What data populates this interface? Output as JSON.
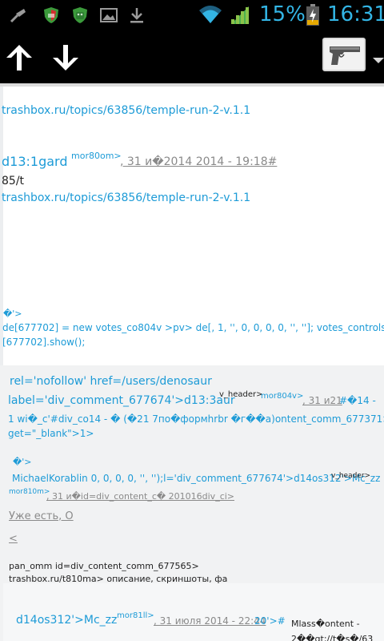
{
  "status_bar": {
    "battery_percent": "15%",
    "time": "16:31",
    "icons": [
      "usb-broom-icon",
      "shield-red-icon",
      "android-green-icon",
      "gallery-icon",
      "download-icon",
      "wifi-icon",
      "signal-icon",
      "battery-icon"
    ]
  },
  "action_bar": {
    "icons": [
      "arrow-up-icon",
      "arrow-down-icon",
      "pistol-icon",
      "dropdown-icon"
    ]
  },
  "content": {
    "link1": "trashbox.ru/topics/63856/temple-run-2-v.1.1",
    "comment1": {
      "author": "d13:1gard",
      "sup": "mor80om>",
      "date": ", 31 и�2014 2014 - 19:18#",
      "body": "85/t",
      "link": "trashbox.ru/topics/63856/temple-run-2-v.1.1"
    },
    "vote_block": {
      "marker": "�'>",
      "line1": "de[677702] = new votes_co804v >pv> de[, 1, '', 0, 0, 0, 0, '', '']; votes_controls[1]",
      "line2": "[677702].show();"
    },
    "reply_block": {
      "line1": "rel='nofollow' href=/users/denosaur",
      "line2_a": "label='div_comment_677674'>d13:3aur",
      "line2_sup1": "v_header>",
      "line2_sup2": "mor804v>",
      "line2_date": ", 31 и21",
      "line2_tail": "#�14 -",
      "line3": "1 wi�_c'#div_co14 - � (�21 7по�формhrbr �г��а)ontent_comm_677371>",
      "line4": "get=\"_blank\">1>"
    },
    "nested": {
      "marker": "�'>",
      "line1_a": "MichaelKorablin 0, 0, 0, 0, '', '');l='div_comment_677674'>d14os312'>Mc_zz",
      "line1_sup": "v_header>",
      "sup2": "mor810m>",
      "date": ", 31 и�id=div_content_c� 201016div_ci>",
      "text": "Уже есть, О",
      "lt": "<",
      "line_a": "pan_omm id=div_content_comm_677565>",
      "line_b": "trashbox.ru/t810ma> описание, скриншоты, фа"
    },
    "last": {
      "author": "d14os312'>Mc_zz",
      "sup": "mor81ll>",
      "date": ", 31 июля 2014 - 22:44",
      "tail": "20'>#",
      "right1": "Mlass�ontent -",
      "right2": "2��gt;//t�s�/63"
    }
  }
}
